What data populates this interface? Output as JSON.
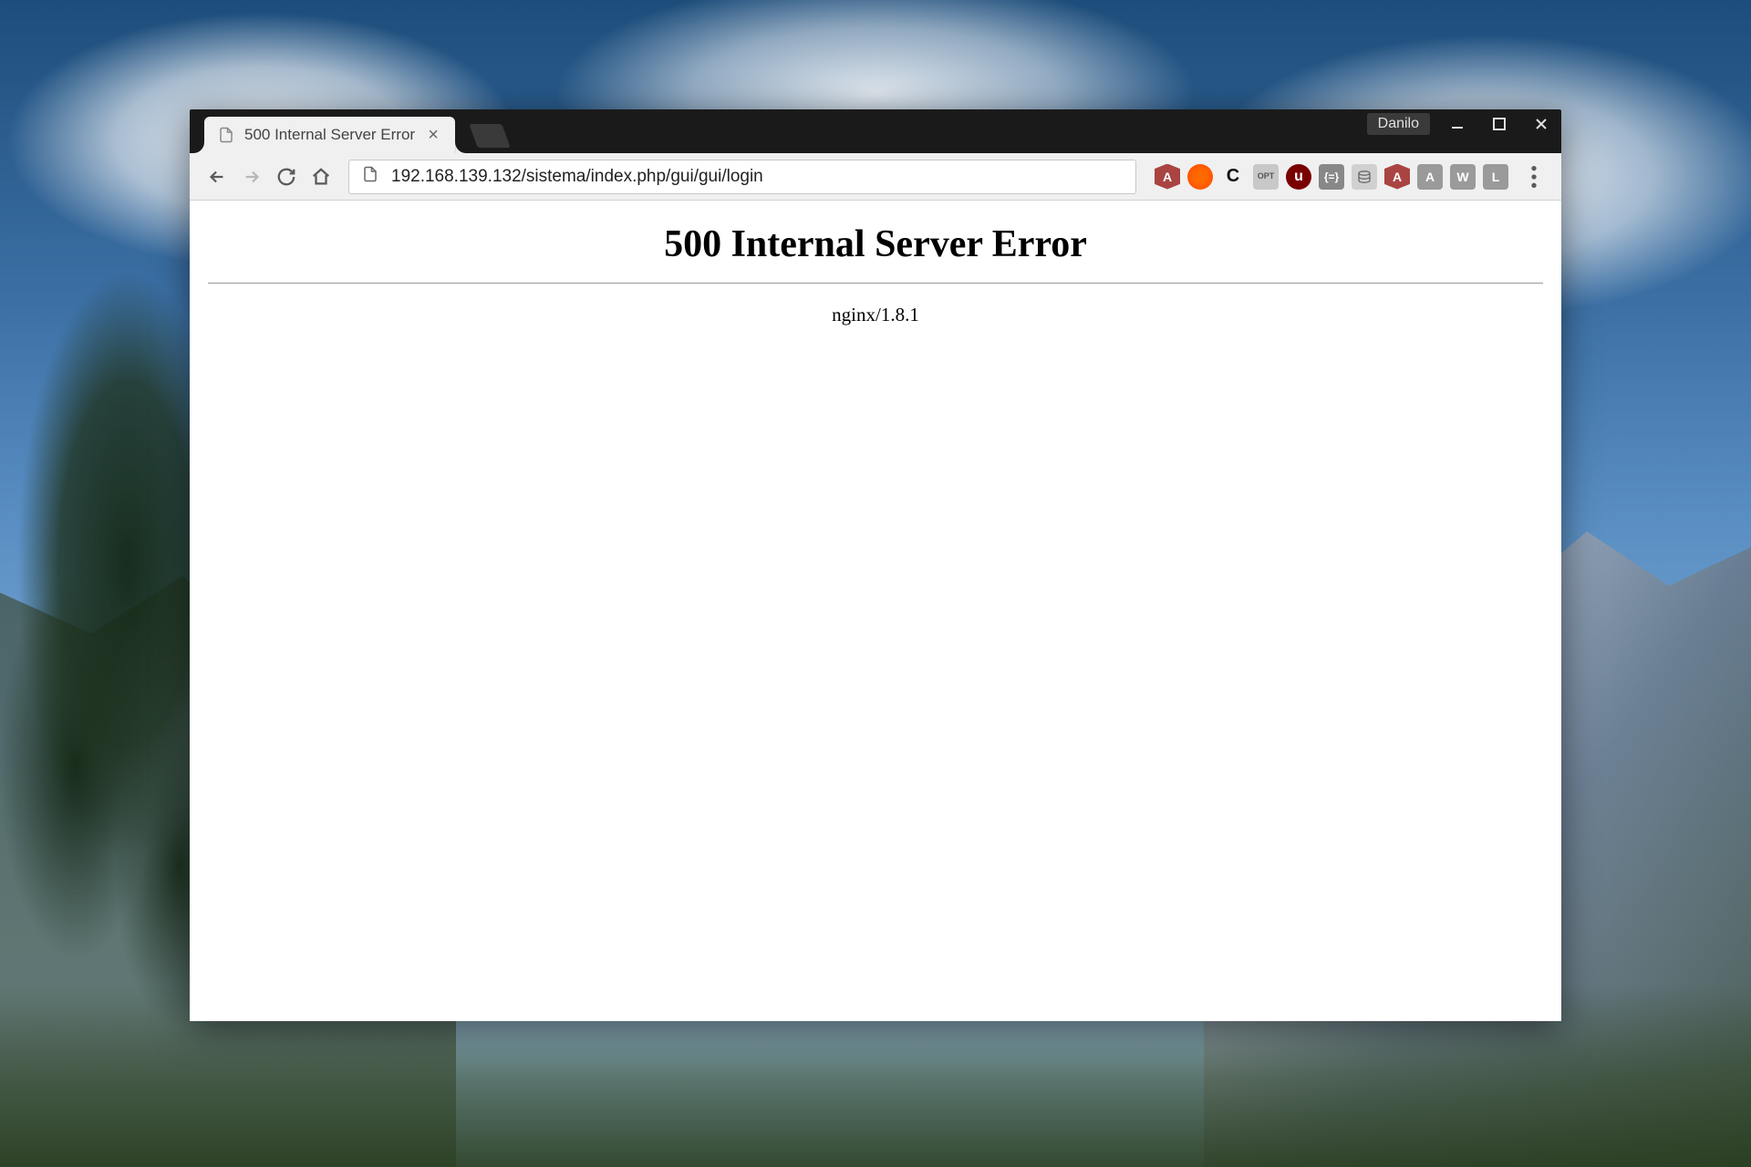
{
  "window": {
    "profile_label": "Danilo"
  },
  "tab": {
    "title": "500 Internal Server Error"
  },
  "address_bar": {
    "url": "192.168.139.132/sistema/index.php/gui/gui/login"
  },
  "extensions": [
    {
      "name": "angular-icon",
      "glyph": "A"
    },
    {
      "name": "brave-icon",
      "glyph": ""
    },
    {
      "name": "c-icon",
      "glyph": "C"
    },
    {
      "name": "opt-icon",
      "glyph": "OPT"
    },
    {
      "name": "ublock-icon",
      "glyph": "u"
    },
    {
      "name": "braces-icon",
      "glyph": "{=}"
    },
    {
      "name": "db-icon",
      "glyph": ""
    },
    {
      "name": "angular2-icon",
      "glyph": "A"
    },
    {
      "name": "a-square-icon",
      "glyph": "A"
    },
    {
      "name": "w-square-icon",
      "glyph": "W"
    },
    {
      "name": "l-square-icon",
      "glyph": "L"
    }
  ],
  "page": {
    "heading": "500 Internal Server Error",
    "server": "nginx/1.8.1"
  }
}
